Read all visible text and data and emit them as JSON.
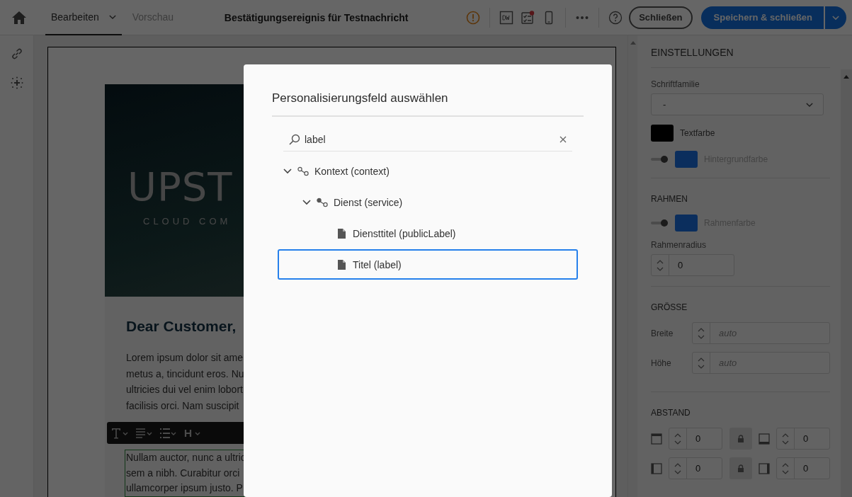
{
  "topbar": {
    "tabs": [
      {
        "label": "Bearbeiten",
        "selected": true,
        "has_menu": true
      },
      {
        "label": "Vorschau",
        "selected": false,
        "has_menu": false
      }
    ],
    "title": "Bestätigungsereignis für Testnachricht",
    "close_button": "Schließen",
    "save_button": "Speichern & schließen"
  },
  "email": {
    "logo": "UPST",
    "logo_tagline": "CLOUD COM",
    "heading": "Dear Customer,",
    "paragraphs": [
      {
        "selected": false,
        "lines": [
          "Lorem ipsum dolor sit ame",
          "metus a, tincidunt eros. Nu",
          "ultricies dui vel enim lobort",
          "facilisis orci. Nam suscipit"
        ]
      },
      {
        "selected": true,
        "lines": [
          "Nullam auctor, nunc a ultric",
          "sem a nibh. Curabitur orci",
          "ullamcorper ipsum justo. P"
        ]
      }
    ]
  },
  "settings": {
    "title": "EINSTELLUNGEN",
    "font_family": {
      "label": "Schriftfamilie",
      "value": "-"
    },
    "text_color": {
      "label": "Textfarbe",
      "color": "#000000"
    },
    "background_color": {
      "label": "Hintergrundfarbe",
      "color": "#0b2e5d",
      "on": false
    },
    "border": {
      "title": "RAHMEN",
      "color": {
        "label": "Rahmenfarbe",
        "color": "#0b2e5d",
        "on": false
      },
      "radius": {
        "label": "Rahmenradius",
        "value": "0"
      }
    },
    "size": {
      "title": "GRÖSSE",
      "fields": [
        {
          "label": "Breite",
          "placeholder": "auto"
        },
        {
          "label": "Höhe",
          "placeholder": "auto"
        }
      ]
    },
    "spacing": {
      "title": "ABSTAND",
      "rows": [
        [
          {
            "kind": "top",
            "value": "0"
          },
          {
            "kind": "bottom",
            "value": "0"
          }
        ],
        [
          {
            "kind": "left",
            "value": "0"
          },
          {
            "kind": "right",
            "value": "0"
          }
        ]
      ]
    }
  },
  "dialog": {
    "title": "Personalisierungsfeld auswählen",
    "search": {
      "value": "label"
    },
    "tree": [
      {
        "label": "Kontext (context)",
        "kind": "node",
        "expanded": true,
        "selected": false,
        "children": [
          {
            "label": "Dienst (service)",
            "kind": "node",
            "expanded": true,
            "selected": false,
            "children": [
              {
                "label": "Diensttitel (publicLabel)",
                "kind": "field",
                "selected": false
              },
              {
                "label": "Titel (label)",
                "kind": "field",
                "selected": true
              }
            ]
          }
        ]
      }
    ]
  }
}
